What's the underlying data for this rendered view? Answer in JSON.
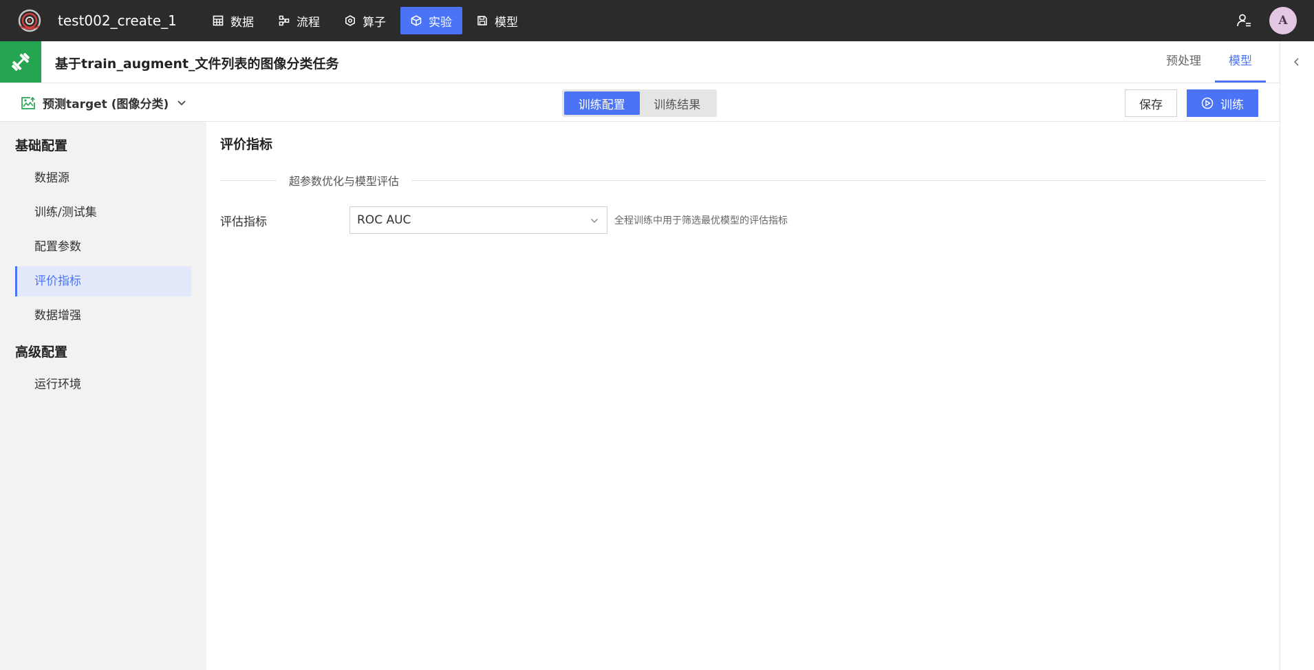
{
  "header": {
    "project_name": "test002_create_1",
    "nav": [
      {
        "label": "数据",
        "icon": "table-icon"
      },
      {
        "label": "流程",
        "icon": "flow-icon"
      },
      {
        "label": "算子",
        "icon": "hexagon-icon"
      },
      {
        "label": "实验",
        "icon": "cube-icon",
        "active": true
      },
      {
        "label": "模型",
        "icon": "save-icon"
      }
    ],
    "avatar_initial": "A"
  },
  "titlebar": {
    "task_title": "基于train_augment_文件列表的图像分类任务",
    "tabs": [
      {
        "label": "预处理"
      },
      {
        "label": "模型",
        "active": true
      }
    ]
  },
  "toolbar": {
    "target_label": "预测target (图像分类)",
    "segments": [
      {
        "label": "训练配置",
        "active": true
      },
      {
        "label": "训练结果"
      }
    ],
    "save_label": "保存",
    "train_label": "训练"
  },
  "sidebar": {
    "groups": [
      {
        "title": "基础配置",
        "items": [
          {
            "label": "数据源"
          },
          {
            "label": "训练/测试集"
          },
          {
            "label": "配置参数"
          },
          {
            "label": "评价指标",
            "active": true
          },
          {
            "label": "数据增强"
          }
        ]
      },
      {
        "title": "高级配置",
        "items": [
          {
            "label": "运行环境"
          }
        ]
      }
    ]
  },
  "main": {
    "section_title": "评价指标",
    "divider_label": "超参数优化与模型评估",
    "metric_label": "评估指标",
    "metric_value": "ROC AUC",
    "metric_hint": "全程训练中用于筛选最优模型的评估指标"
  },
  "colors": {
    "accent": "#4a74f5",
    "topbar": "#2b2b2b",
    "task_icon_bg": "#25a452",
    "sidebar_bg": "#f2f2f2"
  }
}
